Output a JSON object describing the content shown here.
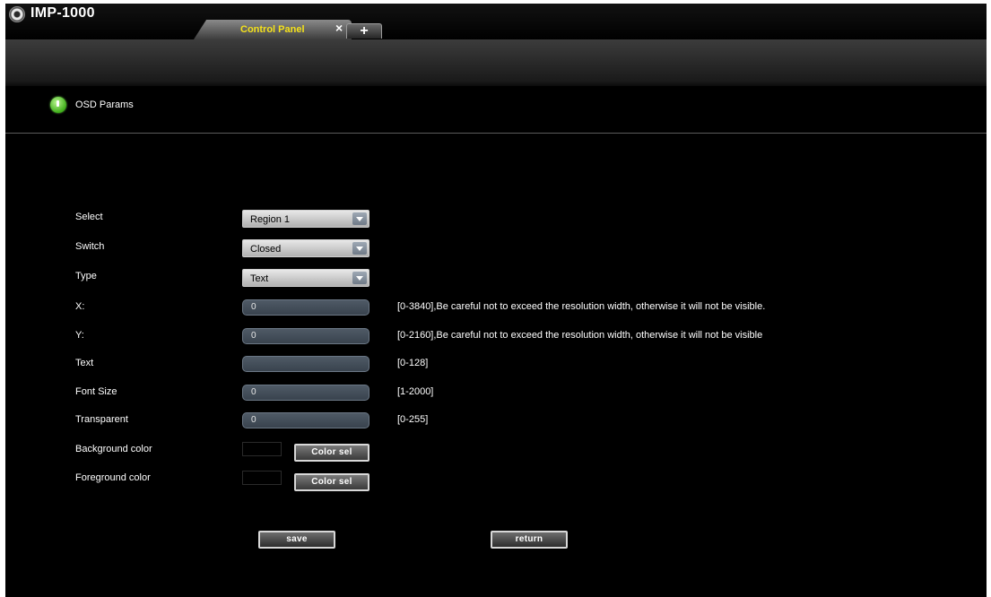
{
  "app": {
    "title": "IMP-1000",
    "logo_icon": "camera-lens-icon"
  },
  "tabs": {
    "active_label": "Control Panel",
    "close_glyph": "×",
    "add_glyph": "+"
  },
  "section": {
    "title": "OSD Params",
    "icon": "info-bubble-icon"
  },
  "form": {
    "select": {
      "label": "Select",
      "value": "Region 1"
    },
    "switch": {
      "label": "Switch",
      "value": "Closed"
    },
    "type": {
      "label": "Type",
      "value": "Text"
    },
    "x": {
      "label": "X:",
      "value": "0",
      "hint": "[0-3840],Be careful not to exceed the resolution width, otherwise it will not be visible."
    },
    "y": {
      "label": "Y:",
      "value": "0",
      "hint": "[0-2160],Be careful not to exceed the resolution width, otherwise it will not be visible"
    },
    "text": {
      "label": "Text",
      "value": "",
      "hint": "[0-128]"
    },
    "font_size": {
      "label": "Font Size",
      "value": "0",
      "hint": "[1-2000]"
    },
    "transparent": {
      "label": "Transparent",
      "value": "0",
      "hint": "[0-255]"
    },
    "background_color": {
      "label": "Background color",
      "button": "Color sel",
      "swatch": "#000000"
    },
    "foreground_color": {
      "label": "Foreground color",
      "button": "Color sel",
      "swatch": "#000000"
    }
  },
  "actions": {
    "save": "save",
    "return": "return"
  },
  "colors": {
    "tab_label": "#f5e21b",
    "background": "#000000",
    "input_fill": "#3f4a55"
  }
}
